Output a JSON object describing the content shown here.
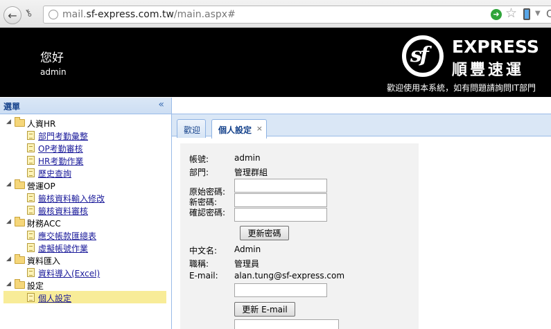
{
  "browser": {
    "url_prefix": "mail.",
    "url_domain": "sf-express.com.tw",
    "url_path": "/main.aspx#"
  },
  "header": {
    "greeting": "您好",
    "username": "admin",
    "logo_text": "sf",
    "brand_en": "EXPRESS",
    "brand_zh": "順豐速運",
    "welcome_note": "歡迎使用本系統，如有問題請詢問IT部門"
  },
  "sidebar": {
    "title": "選單",
    "groups": [
      {
        "label": "人資HR",
        "items": [
          "部門考勤彙整",
          "OP考勤審核",
          "HR考勤作業",
          "歷史查詢"
        ]
      },
      {
        "label": "營運OP",
        "items": [
          "籤核資料輸入修改",
          "籤核資料審核"
        ]
      },
      {
        "label": "財務ACC",
        "items": [
          "應交帳款匯總表",
          "虛擬帳號作業"
        ]
      },
      {
        "label": "資料匯入",
        "items": [
          "資料導入(Excel)"
        ]
      },
      {
        "label": "設定",
        "items": [
          "個人設定"
        ]
      }
    ]
  },
  "tabs": [
    {
      "label": "歡迎"
    },
    {
      "label": "個人設定",
      "close": "×"
    }
  ],
  "form": {
    "account_label": "帳號:",
    "account_value": "admin",
    "department_label": "部門:",
    "department_value": "管理群組",
    "old_password_label": "原始密碼:",
    "new_password_label": "新密碼:",
    "confirm_password_label": "確認密碼:",
    "update_password_button": "更新密碼",
    "chinese_name_label": "中文名:",
    "chinese_name_value": "Admin",
    "job_title_label": "職稱:",
    "job_title_value": "管理員",
    "email_label": "E-mail:",
    "email_value": "alan.tung@sf-express.com",
    "update_email_button": "更新 E-mail"
  },
  "colors": {
    "header_bg": "#000000",
    "panel_header": "#dae7f6",
    "selected_item": "#f8ec98",
    "link": "#1a1a9a"
  }
}
